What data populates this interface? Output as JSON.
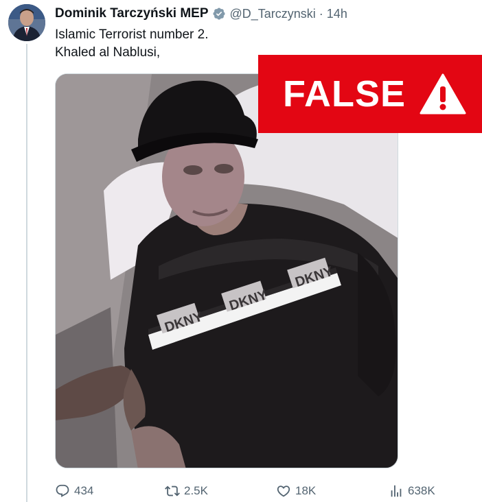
{
  "author": {
    "display_name": "Dominik Tarczyński MEP",
    "handle": "@D_Tarczynski",
    "separator": "·",
    "timestamp": "14h",
    "verified_icon": "verified-badge-icon"
  },
  "tweet": {
    "lines": [
      "Islamic Terrorist number 2.",
      "Khaled al Nablusi,"
    ]
  },
  "overlay": {
    "label": "FALSE",
    "color": "#e30613",
    "icon": "warning-triangle-icon"
  },
  "photo": {
    "shirt_text": "DKNY"
  },
  "actions": {
    "replies": "434",
    "reposts": "2.5K",
    "likes": "18K",
    "views": "638K"
  },
  "colors": {
    "text_primary": "#0f1419",
    "text_secondary": "#536471",
    "verified": "#829aab"
  }
}
